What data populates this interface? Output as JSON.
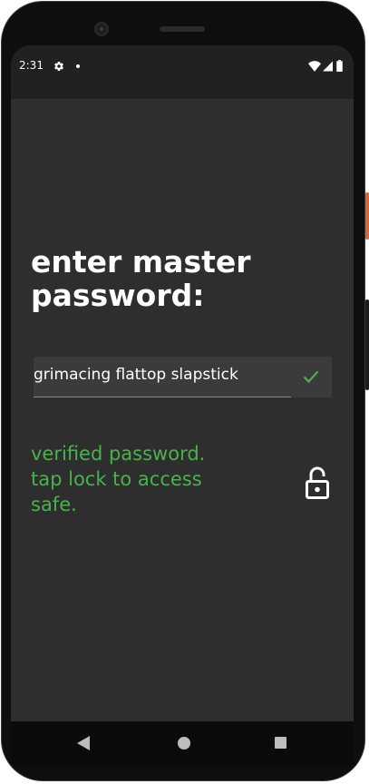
{
  "status_bar": {
    "time": "2:31",
    "icons": [
      "settings-icon",
      "notification-dot-icon",
      "wifi-icon",
      "cell-signal-icon",
      "battery-icon"
    ]
  },
  "screen": {
    "title_line1": "enter master",
    "title_line2": "password:",
    "password_field": {
      "value": "grimacing flattop slapstick",
      "valid": true,
      "indicator_icon": "check-icon"
    },
    "status_message": {
      "line1": "verified password.",
      "line2": "tap lock to access",
      "line3": "safe."
    },
    "lock_button_icon": "lock-open-icon"
  },
  "nav_bar": {
    "buttons": [
      "back-icon",
      "home-icon",
      "recents-icon"
    ]
  },
  "colors": {
    "background": "#2e2e2e",
    "status_bar": "#212121",
    "accent_green": "#4caf50",
    "text": "#ffffff"
  }
}
